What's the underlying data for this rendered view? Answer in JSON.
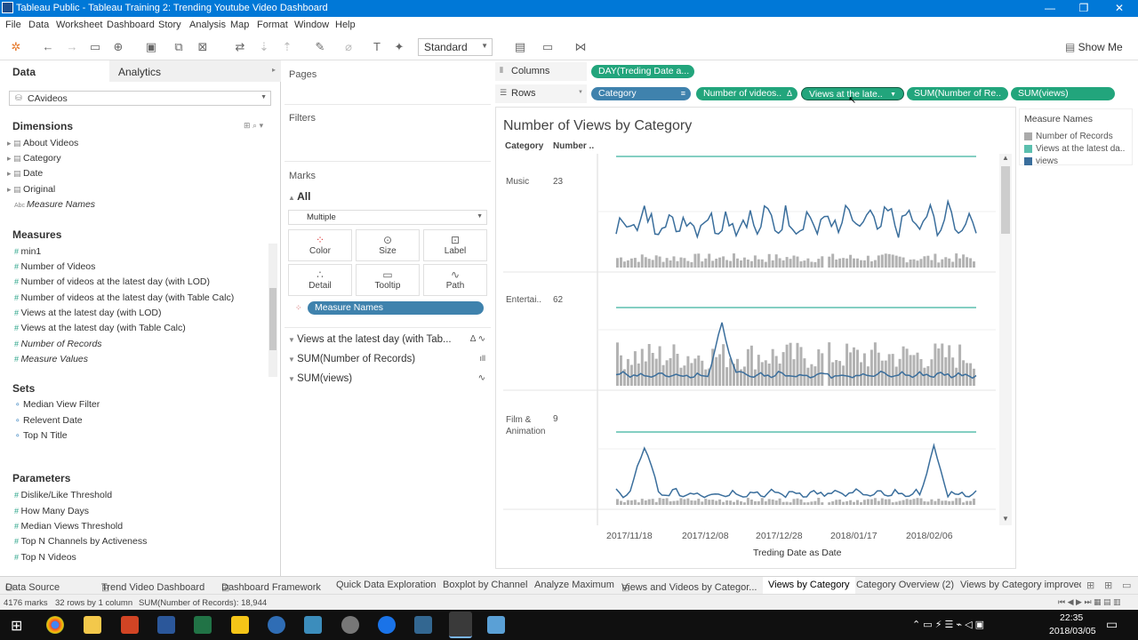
{
  "window": {
    "title": "Tableau Public - Tableau Training 2: Trending Youtube Video Dashboard",
    "min": "—",
    "max": "❐",
    "close": "✕"
  },
  "menu": [
    "File",
    "Data",
    "Worksheet",
    "Dashboard",
    "Story",
    "Analysis",
    "Map",
    "Format",
    "Window",
    "Help"
  ],
  "toolbar": {
    "fit": "Standard",
    "show_me": "Show Me"
  },
  "left": {
    "tabs": {
      "data": "Data",
      "analytics": "Analytics"
    },
    "datasource": "CAvideos",
    "dimensions_title": "Dimensions",
    "dimensions": [
      "About Videos",
      "Category",
      "Date",
      "Original",
      "Measure Names"
    ],
    "measures_title": "Measures",
    "measures": [
      "min1",
      "Number of Videos",
      "Number of videos at the latest day (with LOD)",
      "Number of videos at the latest day (with Table Calc)",
      "Views at the latest day (with LOD)",
      "Views at the latest day (with Table Calc)",
      "Number of Records",
      "Measure Values"
    ],
    "sets_title": "Sets",
    "sets": [
      "Median View Filter",
      "Relevent Date",
      "Top N Title"
    ],
    "params_title": "Parameters",
    "params": [
      "Dislike/Like Threshold",
      "How Many Days",
      "Median Views Threshold",
      "Top N Channels by Activeness",
      "Top N Videos"
    ]
  },
  "cards": {
    "pages": "Pages",
    "filters": "Filters",
    "marks": "Marks",
    "all": "All",
    "mark_type": "Multiple",
    "buttons": [
      "Color",
      "Size",
      "Label",
      "Detail",
      "Tooltip",
      "Path"
    ],
    "measure_names_pill": "Measure Names",
    "mark_cards": [
      "Views at the latest day (with Tab...",
      "SUM(Number of Records)",
      "SUM(views)"
    ],
    "delta": "Δ"
  },
  "shelves": {
    "columns_label": "Columns",
    "rows_label": "Rows",
    "columns": [
      "DAY(Treding Date a..."
    ],
    "rows": [
      "Category",
      "Number of videos..",
      "Views at the late..",
      "SUM(Number of Re..",
      "SUM(views)"
    ]
  },
  "view": {
    "title": "Number of Views by Category",
    "header_category": "Category",
    "header_number": "Number ..",
    "panes": [
      {
        "category": "Music",
        "number": "23"
      },
      {
        "category": "Entertai..",
        "number": "62"
      },
      {
        "category": "Film & Animation",
        "number": "9"
      }
    ],
    "x_ticks": [
      "2017/11/18",
      "2017/12/08",
      "2017/12/28",
      "2018/01/17",
      "2018/02/06"
    ],
    "x_label": "Treding Date as Date"
  },
  "legend": {
    "title": "Measure Names",
    "items": [
      {
        "label": "Number of Records",
        "color": "#aaaaaa"
      },
      {
        "label": "Views at the latest da..",
        "color": "#5bbfae"
      },
      {
        "label": "views",
        "color": "#3a6e9c"
      }
    ]
  },
  "tabs": [
    "Data Source",
    "Trend Video Dashboard",
    "Dashboard Framework",
    "Quick Data Exploration",
    "Boxplot by Channel",
    "Analyze Maximum",
    "Views and Videos by Categor...",
    "Views by Category",
    "Category Overview (2)",
    "Views by Category improved"
  ],
  "status": {
    "marks": "4176 marks",
    "rows": "32 rows by 1 column",
    "sum": "SUM(Number of Records): 18,944"
  },
  "taskbar": {
    "time": "22:35",
    "date": "2018/03/05"
  }
}
